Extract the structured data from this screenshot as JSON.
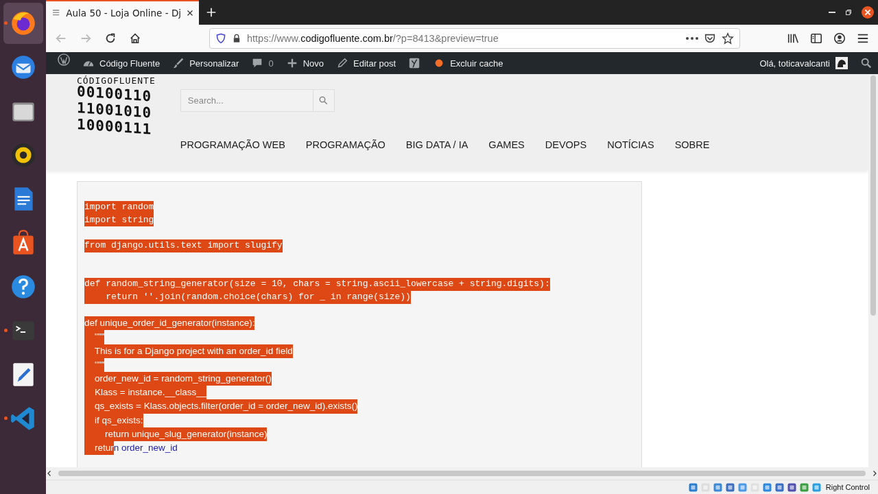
{
  "dock": {
    "items": [
      {
        "selected": true,
        "running": true
      },
      {
        "selected": false,
        "running": false
      },
      {
        "selected": false,
        "running": false
      },
      {
        "selected": false,
        "running": false
      },
      {
        "selected": false,
        "running": false
      },
      {
        "selected": false,
        "running": false
      },
      {
        "selected": false,
        "running": false
      },
      {
        "selected": false,
        "running": true
      },
      {
        "selected": false,
        "running": false
      },
      {
        "selected": false,
        "running": true
      }
    ]
  },
  "browser": {
    "tab": {
      "title": "Aula 50 - Loja Online - Dj"
    },
    "url": {
      "prefix": "https://www.",
      "domain": "codigofluente.com.br",
      "path": "/?p=8413&preview=true"
    }
  },
  "admin_bar": {
    "items": [
      {
        "kind": "logo"
      },
      {
        "kind": "site",
        "label": "Código Fluente"
      },
      {
        "kind": "customize",
        "label": "Personalizar"
      },
      {
        "kind": "comments",
        "label": "0"
      },
      {
        "kind": "new",
        "label": "Novo"
      },
      {
        "kind": "edit",
        "label": "Editar post"
      },
      {
        "kind": "seo"
      },
      {
        "kind": "cache",
        "label": "Excluir cache"
      }
    ],
    "greeting": "Olá, toticavalcanti"
  },
  "site_header": {
    "logo": {
      "name": "CÓDIGOFLUENTE",
      "lines": [
        "00100110",
        "11001010",
        "10000111"
      ]
    },
    "search": {
      "placeholder": "Search..."
    },
    "menu": [
      "PROGRAMAÇÃO WEB",
      "PROGRAMAÇÃO",
      "BIG DATA / IA",
      "GAMES",
      "DEVOPS",
      "NOTÍCIAS",
      "SOBRE"
    ]
  },
  "code": {
    "lines": [
      {
        "kind": "mono",
        "segments": [
          {
            "text": "import random",
            "selected": true
          }
        ]
      },
      {
        "kind": "mono",
        "segments": [
          {
            "text": "import string",
            "selected": true
          }
        ]
      },
      {
        "kind": "blank"
      },
      {
        "kind": "mono",
        "segments": [
          {
            "text": "from django.utils.text import slugify",
            "selected": true
          }
        ]
      },
      {
        "kind": "blank"
      },
      {
        "kind": "blank"
      },
      {
        "kind": "mono",
        "segments": [
          {
            "text": "def random_string_generator(size = 10, chars = string.ascii_lowercase + string.digits):",
            "selected": true
          }
        ]
      },
      {
        "kind": "mono",
        "segments": [
          {
            "text": "    return ''.join(random.choice(chars) for _ in range(size))",
            "selected": true
          }
        ]
      },
      {
        "kind": "blank"
      },
      {
        "kind": "sans",
        "segments": [
          {
            "text": "def unique_order_id_generator(instance):",
            "selected": true
          }
        ]
      },
      {
        "kind": "sans",
        "segments": [
          {
            "text": "    \"\"\"",
            "selected": true
          }
        ]
      },
      {
        "kind": "sans",
        "segments": [
          {
            "text": "    This is for a Django project with an order_id field",
            "selected": true
          }
        ]
      },
      {
        "kind": "sans",
        "segments": [
          {
            "text": "    \"\"\"",
            "selected": true
          }
        ]
      },
      {
        "kind": "sans",
        "segments": [
          {
            "text": "    order_new_id = random_string_generator()",
            "selected": true
          }
        ]
      },
      {
        "kind": "sans",
        "segments": [
          {
            "text": "    Klass = instance.__class__",
            "selected": true
          }
        ]
      },
      {
        "kind": "sans",
        "segments": [
          {
            "text": "    qs_exists = Klass.objects.filter(order_id = order_new_id).exists()",
            "selected": true
          }
        ]
      },
      {
        "kind": "sans",
        "segments": [
          {
            "text": "    if qs_exists:",
            "selected": true
          }
        ]
      },
      {
        "kind": "sans",
        "segments": [
          {
            "text": "        return unique_slug_generator(instance)",
            "selected": true
          }
        ]
      },
      {
        "kind": "sans",
        "segments": [
          {
            "text": "    retur",
            "selected": true
          },
          {
            "text": "n order_new_id",
            "selected": false
          }
        ]
      }
    ]
  },
  "status_bar": {
    "host_key": "Right Control"
  }
}
